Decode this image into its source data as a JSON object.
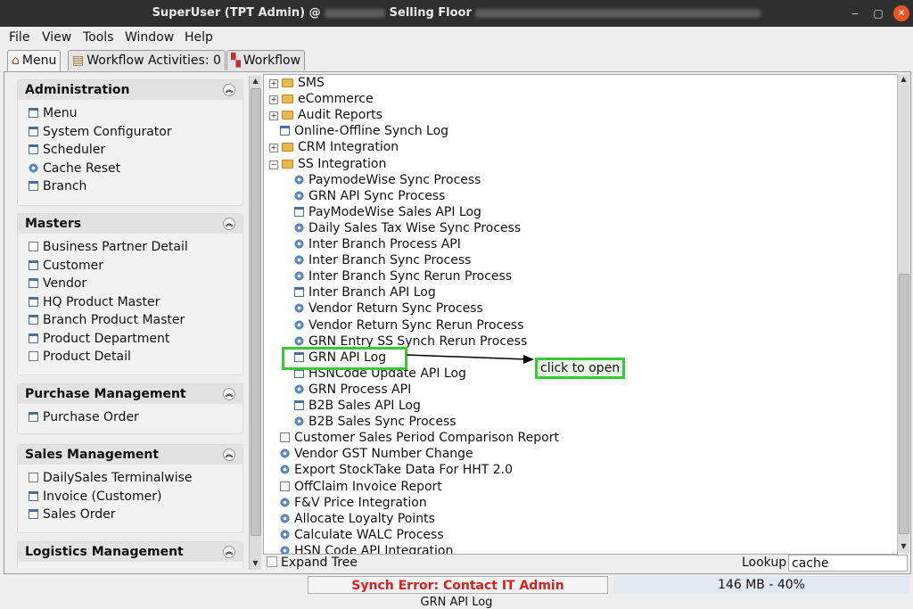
{
  "window": {
    "title_prefix": "SuperUser (TPT Admin) @",
    "title_mid": "Selling Floor",
    "minimize": "‒",
    "maximize": "▢",
    "close": "✕"
  },
  "menubar": [
    "File",
    "View",
    "Tools",
    "Window",
    "Help"
  ],
  "tabs": [
    {
      "label": "Menu",
      "icon": "home-icon"
    },
    {
      "label": "Workflow Activities: 0",
      "icon": "table-icon"
    },
    {
      "label": "Workflow",
      "icon": "workflow-icon"
    }
  ],
  "sidebar": {
    "sections": [
      {
        "title": "Administration",
        "items": [
          {
            "label": "Menu",
            "icon": "window-icon"
          },
          {
            "label": "System Configurator",
            "icon": "window-icon"
          },
          {
            "label": "Scheduler",
            "icon": "window-icon"
          },
          {
            "label": "Cache Reset",
            "icon": "gear-icon"
          },
          {
            "label": "Branch",
            "icon": "window-icon"
          }
        ]
      },
      {
        "title": "Masters",
        "items": [
          {
            "label": "Business Partner Detail",
            "icon": "document-icon"
          },
          {
            "label": "Customer",
            "icon": "window-icon"
          },
          {
            "label": "Vendor",
            "icon": "window-icon"
          },
          {
            "label": "HQ Product Master",
            "icon": "window-icon"
          },
          {
            "label": "Branch Product Master",
            "icon": "window-icon"
          },
          {
            "label": "Product Department",
            "icon": "window-icon"
          },
          {
            "label": "Product Detail",
            "icon": "document-icon"
          }
        ]
      },
      {
        "title": "Purchase Management",
        "items": [
          {
            "label": "Purchase Order",
            "icon": "window-icon"
          }
        ]
      },
      {
        "title": "Sales Management",
        "items": [
          {
            "label": "DailySales Terminalwise",
            "icon": "document-icon"
          },
          {
            "label": "Invoice (Customer)",
            "icon": "window-icon"
          },
          {
            "label": "Sales Order",
            "icon": "window-icon"
          }
        ]
      },
      {
        "title": "Logistics Management",
        "items": []
      }
    ]
  },
  "tree": {
    "rows": [
      {
        "label": "SMS",
        "type": "folder",
        "level": 0,
        "expander": "+"
      },
      {
        "label": "eCommerce",
        "type": "folder",
        "level": 0,
        "expander": "+"
      },
      {
        "label": "Audit Reports",
        "type": "folder",
        "level": 0,
        "expander": "+"
      },
      {
        "label": "Online-Offline Synch Log",
        "type": "window",
        "level": 0
      },
      {
        "label": "CRM Integration",
        "type": "folder",
        "level": 0,
        "expander": "+"
      },
      {
        "label": "SS Integration",
        "type": "folder",
        "level": 0,
        "expander": "−"
      },
      {
        "label": "PaymodeWise Sync Process",
        "type": "gear",
        "level": 1
      },
      {
        "label": "GRN API Sync Process",
        "type": "gear",
        "level": 1
      },
      {
        "label": "PayModeWise Sales API Log",
        "type": "window",
        "level": 1
      },
      {
        "label": "Daily Sales Tax Wise Sync Process",
        "type": "gear",
        "level": 1
      },
      {
        "label": "Inter Branch Process API",
        "type": "gear",
        "level": 1
      },
      {
        "label": "Inter Branch Sync Process",
        "type": "gear",
        "level": 1
      },
      {
        "label": "Inter Branch Sync Rerun Process",
        "type": "gear",
        "level": 1
      },
      {
        "label": "Inter Branch API Log",
        "type": "window",
        "level": 1
      },
      {
        "label": "Vendor Return Sync Process",
        "type": "gear",
        "level": 1
      },
      {
        "label": "Vendor Return Sync Rerun Process",
        "type": "gear",
        "level": 1
      },
      {
        "label": "GRN Entry SS Synch Rerun Process",
        "type": "gear",
        "level": 1
      },
      {
        "label": "GRN API Log",
        "type": "window",
        "level": 1,
        "highlighted": true
      },
      {
        "label": "HSNCode Update API Log",
        "type": "window",
        "level": 1
      },
      {
        "label": "GRN Process API",
        "type": "gear",
        "level": 1
      },
      {
        "label": "B2B Sales API Log",
        "type": "window",
        "level": 1
      },
      {
        "label": "B2B Sales Sync Process",
        "type": "gear",
        "level": 1
      },
      {
        "label": "Customer Sales Period Comparison Report",
        "type": "document",
        "level": 0
      },
      {
        "label": "Vendor GST Number Change",
        "type": "gear",
        "level": 0
      },
      {
        "label": "Export StockTake Data For HHT 2.0",
        "type": "gear",
        "level": 0
      },
      {
        "label": "OffClaim Invoice Report",
        "type": "document",
        "level": 0
      },
      {
        "label": "F&V Price Integration",
        "type": "gear",
        "level": 0
      },
      {
        "label": "Allocate Loyalty Points",
        "type": "gear",
        "level": 0
      },
      {
        "label": "Calculate WALC Process",
        "type": "gear",
        "level": 0
      },
      {
        "label": "HSN Code API Integration",
        "type": "gear",
        "level": 0
      }
    ]
  },
  "annotation": {
    "callout": "click to open"
  },
  "bottom": {
    "expand_tree": "Expand Tree",
    "lookup_label": "Lookup",
    "lookup_value": "cache"
  },
  "status": {
    "synch_error": "Synch Error: Contact IT Admin",
    "memory": "146 MB - 40%"
  },
  "footer": {
    "selected": "GRN API Log"
  }
}
